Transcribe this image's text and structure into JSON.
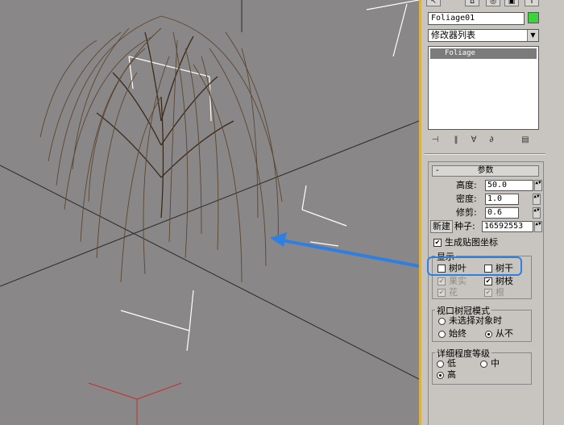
{
  "panel": {
    "object_name": "Foliage01",
    "object_color": "#3ed33e",
    "modifier_list": "修改器列表",
    "stack_item": "Foliage",
    "top_icons": [
      "pointer-icon",
      "hierarchy-icon",
      "motion-icon",
      "display-icon"
    ]
  },
  "params": {
    "header": "参数",
    "collapse_glyph": "-",
    "height_label": "高度:",
    "height_value": "50.0",
    "density_label": "密度:",
    "density_value": "1.0",
    "prune_label": "修剪:",
    "prune_value": "0.6",
    "new_button": "新建",
    "seed_label": "种子:",
    "seed_value": "16592553",
    "gen_mapping": "生成贴图坐标",
    "show_group": "显示",
    "leaves": "树叶",
    "trunk": "树干",
    "fruit": "果实",
    "branches": "树枝",
    "flowers": "花",
    "roots": "根"
  },
  "canopy": {
    "group": "视口树冠模式",
    "when_unselected": "未选择对象时",
    "always": "始终",
    "never": "从不"
  },
  "detail": {
    "group": "详细程度等级",
    "low": "低",
    "medium": "中",
    "high": "高"
  },
  "colors": {
    "panel_border": "#d9b34a",
    "highlight": "#2f7fe0",
    "viewport_bg": "#8a8788"
  }
}
